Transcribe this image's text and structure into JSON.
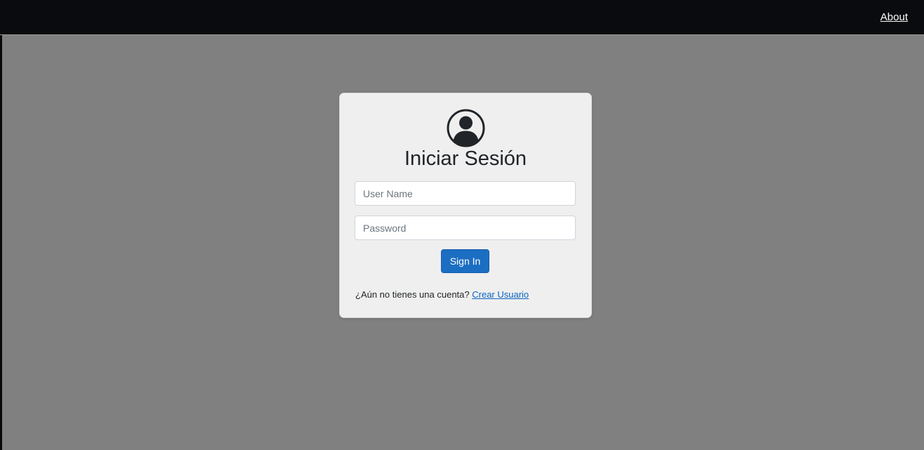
{
  "nav": {
    "about_label": "About"
  },
  "login": {
    "title": "Iniciar Sesión",
    "avatar_icon": "user-circle-icon",
    "username_placeholder": "User Name",
    "password_placeholder": "Password",
    "signin_label": "Sign In",
    "signup_prompt": "¿Aún no tienes una cuenta?",
    "signup_link_label": "Crear Usuario"
  },
  "colors": {
    "topbar": "#0a0b0e",
    "background": "#808080",
    "card": "#efefef",
    "primary_button": "#1b6ec2",
    "link": "#0b64c0"
  }
}
